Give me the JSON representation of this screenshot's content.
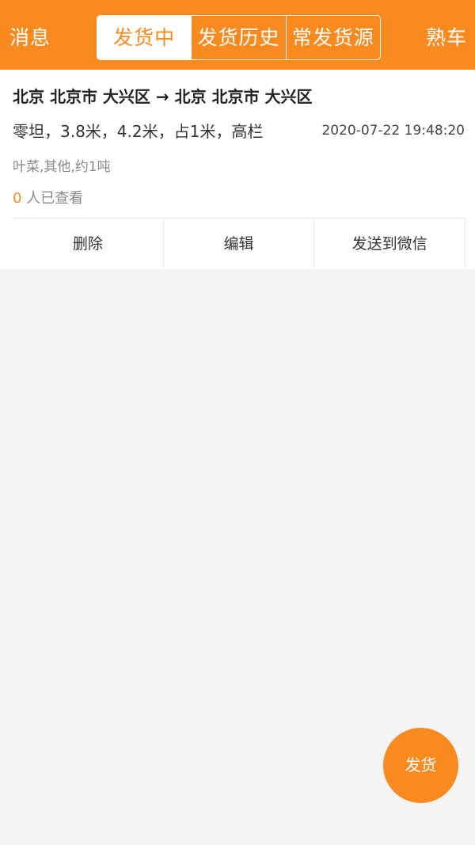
{
  "header": {
    "left_label": "消息",
    "right_label": "熟车",
    "tabs": [
      {
        "label": "发货中",
        "active": true
      },
      {
        "label": "发货历史",
        "active": false
      },
      {
        "label": "常发货源",
        "active": false
      }
    ]
  },
  "order": {
    "route": "北京 北京市 大兴区 → 北京 北京市 大兴区",
    "specs": "零坦，3.8米，4.2米，占1米，高栏",
    "time": "2020-07-22 19:48:20",
    "cargo": "叶菜,其他,约1吨",
    "view_count": "0",
    "view_suffix": "人已查看",
    "actions": {
      "delete_label": "删除",
      "edit_label": "编辑",
      "share_label": "发送到微信"
    }
  },
  "fab": {
    "label": "发货"
  },
  "colors": {
    "accent": "#f98a20",
    "background": "#f4f4f4"
  }
}
